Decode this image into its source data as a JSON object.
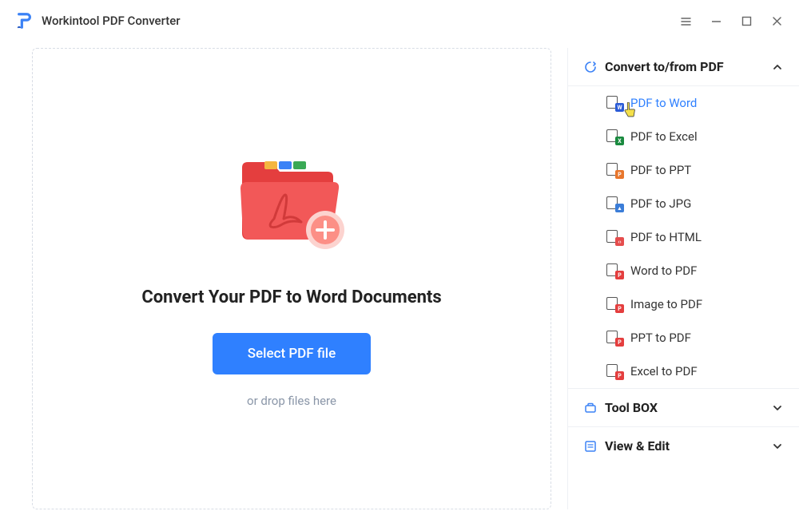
{
  "app": {
    "title": "Workintool PDF Converter"
  },
  "main": {
    "heading": "Convert Your PDF to Word Documents",
    "select_button": "Select PDF file",
    "drop_hint": "or drop files here"
  },
  "sidebar": {
    "categories": [
      {
        "title": "Convert to/from PDF",
        "expanded": true
      },
      {
        "title": "Tool BOX",
        "expanded": false
      },
      {
        "title": "View & Edit",
        "expanded": false
      }
    ],
    "convert_items": [
      {
        "label": "PDF to Word",
        "overlay": "W",
        "overlay_style": "ov-word",
        "active": true
      },
      {
        "label": "PDF to Excel",
        "overlay": "X",
        "overlay_style": "ov-excel",
        "active": false
      },
      {
        "label": "PDF to PPT",
        "overlay": "P",
        "overlay_style": "ov-ppt",
        "active": false
      },
      {
        "label": "PDF to JPG",
        "overlay": "",
        "overlay_style": "ov-jpg",
        "active": false
      },
      {
        "label": "PDF to HTML",
        "overlay": "",
        "overlay_style": "ov-html",
        "active": false
      },
      {
        "label": "Word to PDF",
        "overlay": "P",
        "overlay_style": "ov-pdf",
        "active": false
      },
      {
        "label": "Image to PDF",
        "overlay": "P",
        "overlay_style": "ov-pdf",
        "active": false
      },
      {
        "label": "PPT to PDF",
        "overlay": "P",
        "overlay_style": "ov-pdf",
        "active": false
      },
      {
        "label": "Excel to PDF",
        "overlay": "P",
        "overlay_style": "ov-pdf",
        "active": false
      }
    ]
  }
}
